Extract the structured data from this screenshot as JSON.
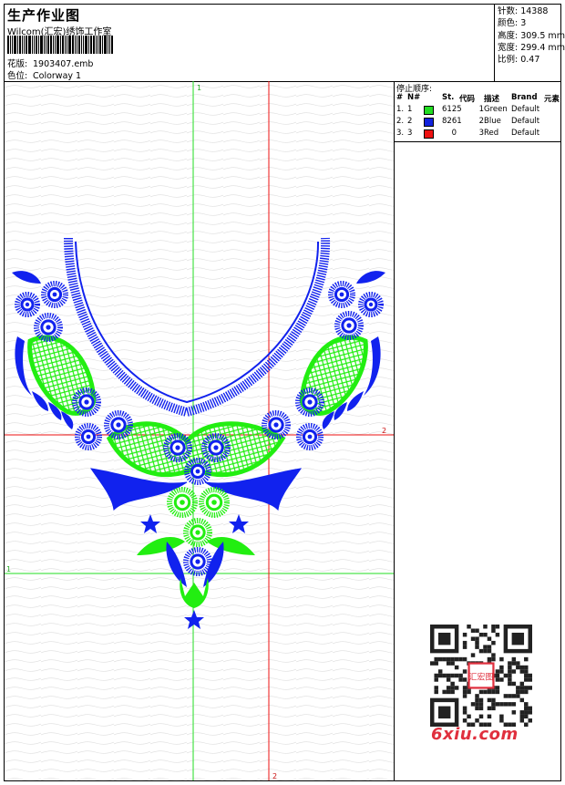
{
  "header": {
    "title": "生产作业图",
    "studio": "Wilcom(汇宏)绣饰工作室",
    "design_label": "花版:",
    "design_value": "1903407.emb",
    "colorway_label": "色位:",
    "colorway_value": "Colorway 1"
  },
  "stats": {
    "stitches": "针数: 14388",
    "colors": "颜色: 3",
    "height": "高度: 309.5 mm",
    "width": "宽度: 299.4 mm",
    "scale": "比例: 0.47"
  },
  "stop_sequence": {
    "title": "停止顺序:",
    "columns": [
      "#",
      "N#",
      "St.",
      "代码",
      "描述",
      "Brand",
      "元素"
    ],
    "rows": [
      {
        "index": "1.",
        "n": "1",
        "color": "#22dd22",
        "st": "6125",
        "code": "1",
        "desc": "Green",
        "brand": "Default"
      },
      {
        "index": "2.",
        "n": "2",
        "color": "#1122dd",
        "st": "8261",
        "code": "2",
        "desc": "Blue",
        "brand": "Default"
      },
      {
        "index": "3.",
        "n": "3",
        "color": "#ee1111",
        "st": "0",
        "code": "3",
        "desc": "Red",
        "brand": "Default"
      }
    ]
  },
  "axes": {
    "green_top": "1",
    "green_left": "1",
    "red_right": "2",
    "red_bottom": "2"
  },
  "watermark": {
    "stamp": "汇宏图",
    "site": "6xiu.com"
  },
  "colors": {
    "thread_green": "#22ee11",
    "thread_blue": "#1122ee",
    "guide_green": "#22dd22",
    "guide_red": "#ee1111",
    "watermark_red": "#e0303e"
  }
}
